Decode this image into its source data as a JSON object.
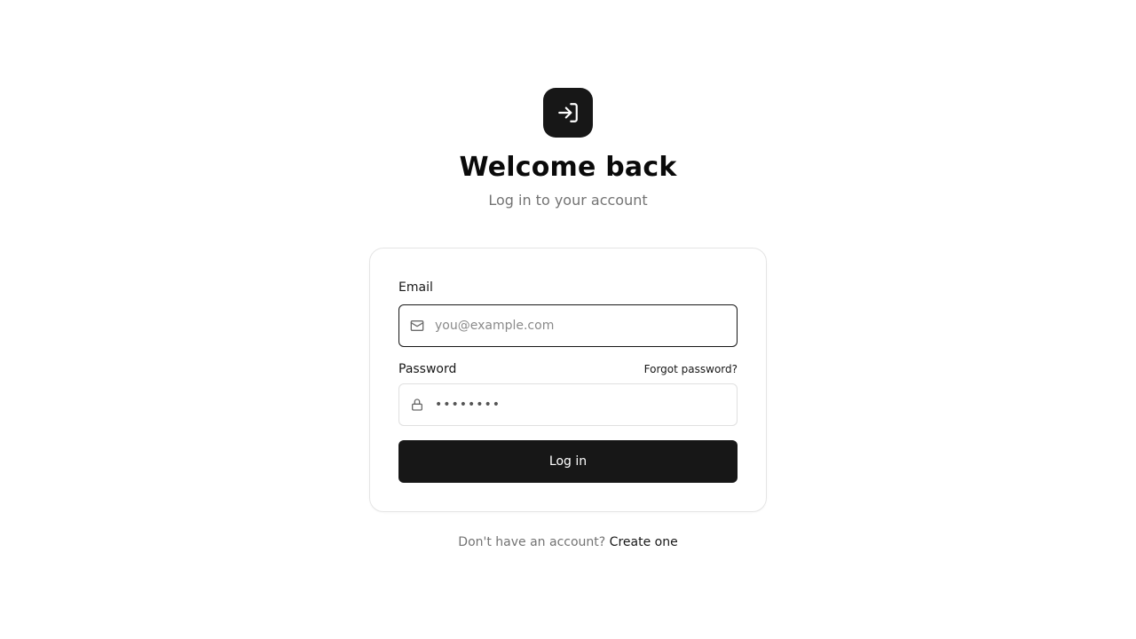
{
  "header": {
    "logo_icon": "login-arrow-icon",
    "title": "Welcome back",
    "subtitle": "Log in to your account"
  },
  "form": {
    "email": {
      "label": "Email",
      "placeholder": "you@example.com",
      "value": "",
      "icon": "mail-icon"
    },
    "password": {
      "label": "Password",
      "forgot_label": "Forgot password?",
      "value": "••••••••",
      "icon": "lock-icon"
    },
    "submit_label": "Log in"
  },
  "footer": {
    "prompt": "Don't have an account?",
    "link_label": "Create one"
  },
  "colors": {
    "primary": "#171717",
    "muted_text": "#737373",
    "border": "#e5e5e5",
    "background": "#ffffff"
  }
}
